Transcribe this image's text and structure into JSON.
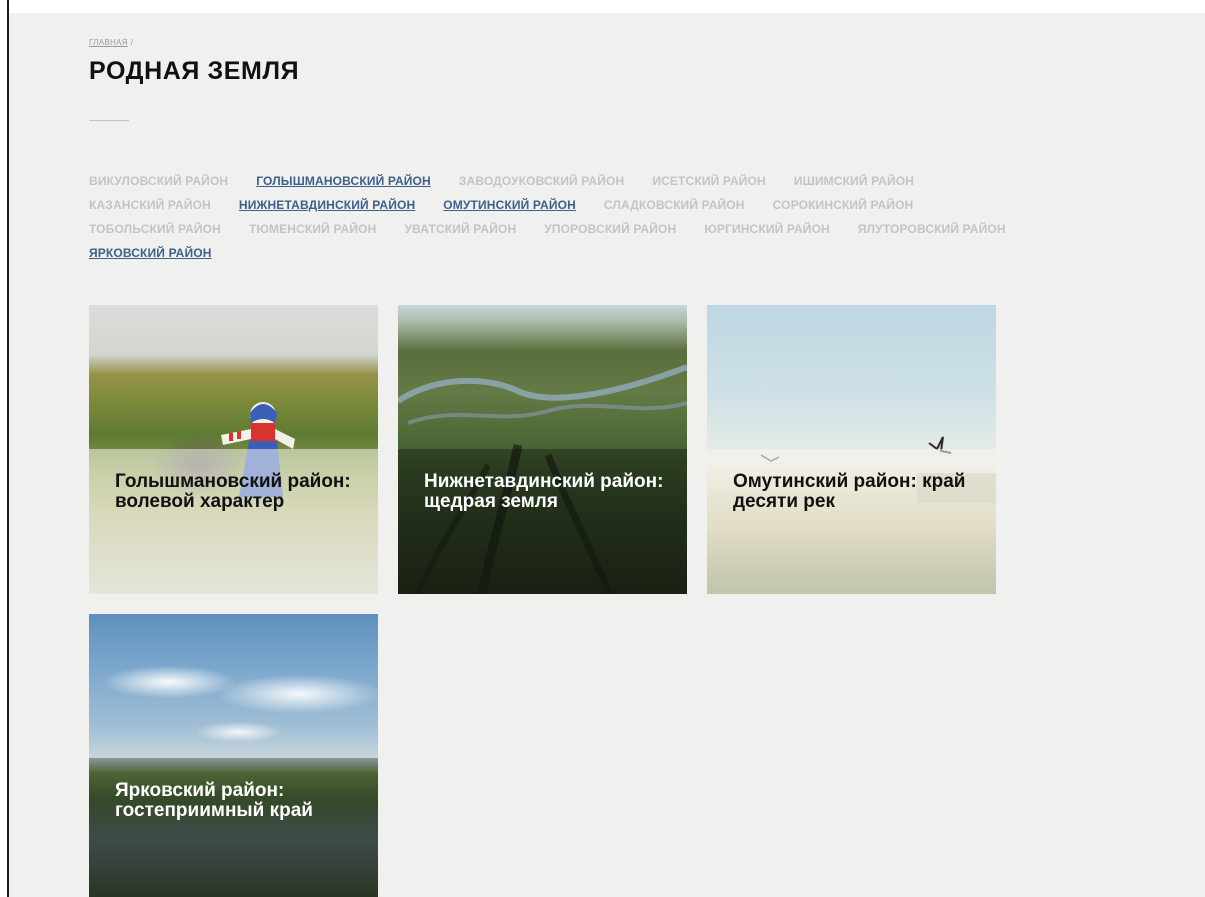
{
  "breadcrumb": {
    "home_label": "ГЛАВНАЯ",
    "separator": "/"
  },
  "page": {
    "title": "РОДНАЯ ЗЕМЛЯ"
  },
  "districts": {
    "rows": [
      [
        {
          "label": "ВИКУЛОВСКИЙ РАЙОН",
          "active": false
        },
        {
          "label": "ГОЛЫШМАНОВСКИЙ РАЙОН",
          "active": true
        },
        {
          "label": "ЗАВОДОУКОВСКИЙ РАЙОН",
          "active": false
        },
        {
          "label": "ИСЕТСКИЙ РАЙОН",
          "active": false
        },
        {
          "label": "ИШИМСКИЙ РАЙОН",
          "active": false
        }
      ],
      [
        {
          "label": "КАЗАНСКИЙ РАЙОН",
          "active": false
        },
        {
          "label": "НИЖНЕТАВДИНСКИЙ РАЙОН",
          "active": true
        },
        {
          "label": "ОМУТИНСКИЙ РАЙОН",
          "active": true
        },
        {
          "label": "СЛАДКОВСКИЙ РАЙОН",
          "active": false
        },
        {
          "label": "СОРОКИНСКИЙ РАЙОН",
          "active": false
        }
      ],
      [
        {
          "label": "ТОБОЛЬСКИЙ РАЙОН",
          "active": false
        },
        {
          "label": "ТЮМЕНСКИЙ РАЙОН",
          "active": false
        },
        {
          "label": "УВАТСКИЙ РАЙОН",
          "active": false
        },
        {
          "label": "УПОРОВСКИЙ РАЙОН",
          "active": false
        },
        {
          "label": "ЮРГИНСКИЙ РАЙОН",
          "active": false
        },
        {
          "label": "ЯЛУТОРОВСКИЙ РАЙОН",
          "active": false
        }
      ],
      [
        {
          "label": "ЯРКОВСКИЙ РАЙОН",
          "active": true
        }
      ]
    ]
  },
  "cards": [
    {
      "title": "Голышмановский район: волевой характер",
      "image": "forest-doll-photo"
    },
    {
      "title": "Нижнетавдинский район: щедрая земля",
      "image": "river-valley-aerial-photo"
    },
    {
      "title": "Омутинский район: край десяти рек",
      "image": "field-sky-birds-photo"
    },
    {
      "title": "Ярковский район: гостеприимный край",
      "image": "lake-clouds-photo"
    }
  ],
  "colors": {
    "page_background": "#f0f0ef",
    "active_link": "#3e5f8a",
    "inactive_link": "#c4c4c4",
    "title": "#111111"
  }
}
